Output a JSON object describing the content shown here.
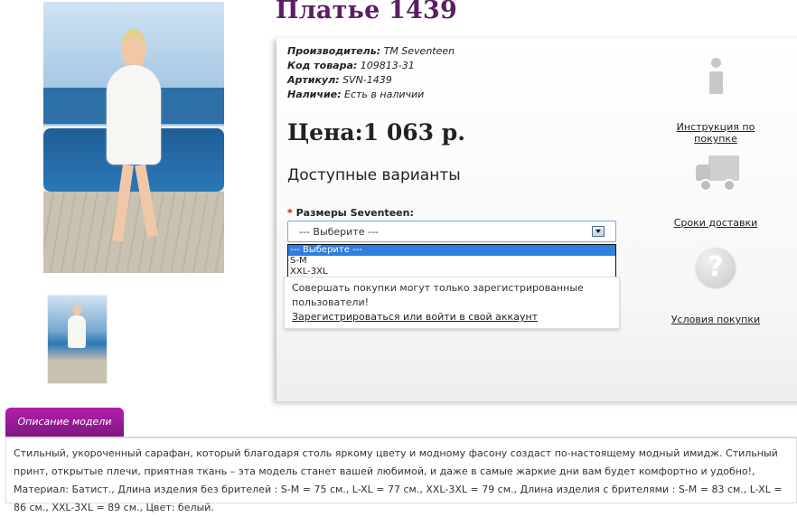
{
  "product": {
    "title": "Платье 1439",
    "manufacturer_label": "Производитель:",
    "manufacturer": "TM Seventeen",
    "code_label": "Код товара:",
    "code": "109813-31",
    "article_label": "Артикул:",
    "article": "SVN-1439",
    "availability_label": "Наличие:",
    "availability": "Есть в наличии",
    "price": "Цена:1 063 р."
  },
  "variants": {
    "title": "Доступные варианты",
    "required_mark": "*",
    "size_label": "Размеры Seventeen:",
    "selected": "--- Выберите ---",
    "options": [
      "--- Выберите ---",
      "S-M",
      "XXL-3XL"
    ]
  },
  "login_note": {
    "text": "Совершать покупки могут только зарегистрированные пользователи!",
    "link": "Зарегистрироваться или войти в свой аккаунт"
  },
  "side_links": {
    "instructions": "Инструкция по покупке",
    "delivery": "Сроки доставки",
    "terms": "Условия покупки"
  },
  "icons": [
    "info-icon",
    "truck-icon",
    "question-icon"
  ],
  "description": {
    "tab": "Описание модели",
    "text": "Стильный, укороченный сарафан, который благодаря столь яркому цвету и модному фасону создаст по-настоящему модный имидж. Стильный принт, открытые плечи, приятная ткань – эта модель станет вашей любимой, и даже в самые жаркие дни вам будет комфортно и удобно!, Материал: Батист., Длина изделия без брителей : S-M = 75 см., L-XL = 77 см., XXL-3XL = 79 см., Длина изделия с брителями : S-M = 83 см., L-XL = 86 см., XXL-3XL = 89 см., Цвет: белый."
  },
  "colors": {
    "title": "#5b1e64",
    "tab": "#a01c9c",
    "dropdown_highlight": "#2f7fe0"
  }
}
